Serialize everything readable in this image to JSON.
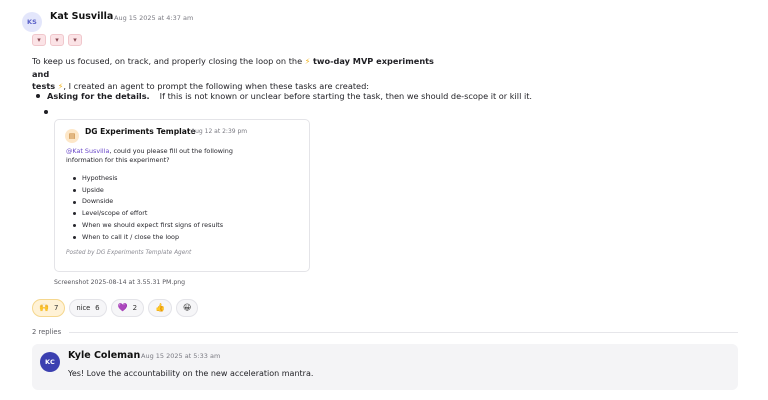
{
  "message": {
    "avatar_initials": "KS",
    "author": "Kat Susvilla",
    "timestamp": "Aug 15 2025 at 4:37 am",
    "mini_emojis": [
      "basket-icon",
      "basket-icon",
      "basket-icon"
    ],
    "paragraph": {
      "pre": "To keep us focused, on track, and properly closing the loop on the",
      "bold1": "two-day MVP experiments and",
      "bold2": "tests",
      "post": ", I created an agent to prompt the following when these tasks are created:"
    },
    "bullet": {
      "strong": "Asking for the details.",
      "text": "If this is not known or unclear before starting the task, then we should de-scope it or kill it."
    }
  },
  "card": {
    "avatar_icon": "template-agent-icon",
    "author": "DG Experiments Template",
    "timestamp": "Aug 12 at 2:39 pm",
    "mention": "@Kat Susvilla",
    "body_rest_line1": ", could you please fill out the following",
    "body_line2": "information for this experiment?",
    "items": [
      "Hypothesis",
      "Upside",
      "Downside",
      "Level/scope of effort",
      "When we should expect first signs of results",
      "When to call it / close the loop"
    ],
    "footer": "Posted by DG Experiments Template Agent"
  },
  "attachment_caption": "Screenshot 2025-08-14 at 3.55.31 PM.png",
  "reactions": [
    {
      "icon": "raised-hands-icon",
      "glyph": "🙌",
      "count": "7",
      "active": true
    },
    {
      "icon": "nice-text-icon",
      "glyph": "nice",
      "count": "6",
      "active": false
    },
    {
      "icon": "purple-heart-icon",
      "glyph": "💜",
      "count": "2",
      "active": false
    },
    {
      "icon": "thumbs-up-icon",
      "glyph": "👍",
      "count": "",
      "active": false
    },
    {
      "icon": "add-reaction-icon",
      "glyph": "😀",
      "count": "",
      "active": false
    }
  ],
  "replies": {
    "label": "2 replies",
    "reply": {
      "avatar_initials": "KC",
      "author": "Kyle Coleman",
      "timestamp": "Aug 15 2025 at 5:33 am",
      "text": "Yes! Love the accountability on the new acceleration mantra."
    }
  },
  "colors": {
    "mention": "#6a49c9",
    "active_reaction_bg": "#fff2d6",
    "reply_avatar": "#3b3fb0"
  }
}
